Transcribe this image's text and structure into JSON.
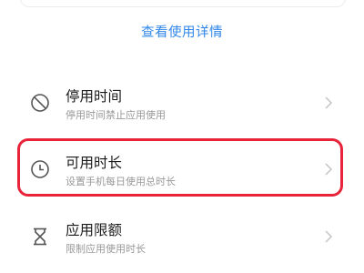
{
  "details_link": "查看使用详情",
  "items": [
    {
      "title": "停用时间",
      "subtitle": "停用时间禁止应用使用",
      "icon": "block-icon"
    },
    {
      "title": "可用时长",
      "subtitle": "设置手机每日使用总时长",
      "icon": "clock-icon"
    },
    {
      "title": "应用限额",
      "subtitle": "限制应用使用时长",
      "icon": "hourglass-icon"
    }
  ],
  "colors": {
    "link": "#2f86e8",
    "highlight": "#e8233a",
    "title": "#1a1a1a",
    "subtitle": "#999999",
    "icon": "#555555"
  }
}
